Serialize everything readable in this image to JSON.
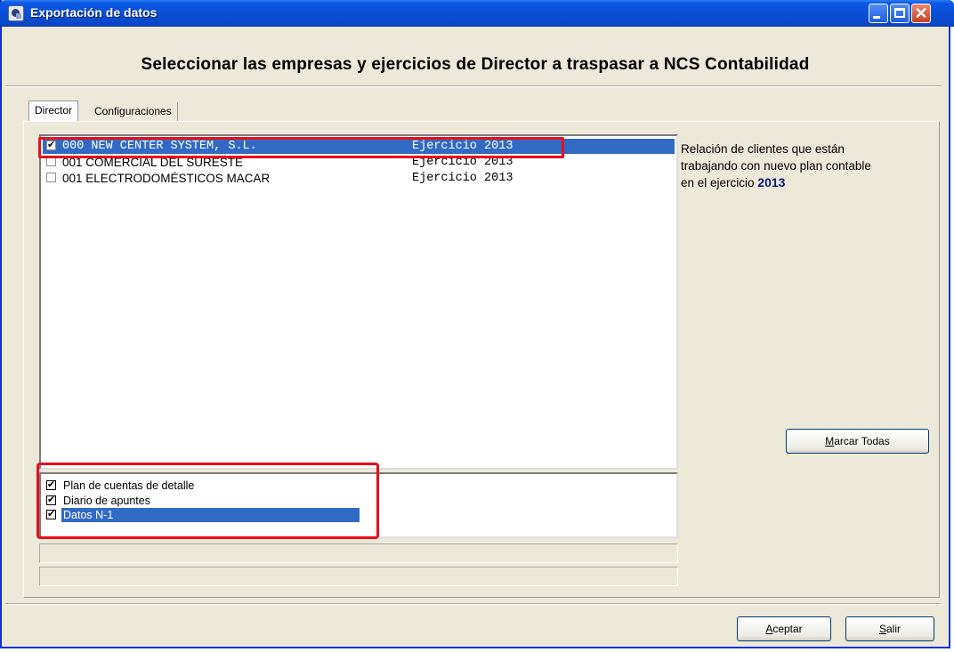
{
  "window": {
    "title": "Exportación de datos",
    "close_glyph": "✕"
  },
  "heading": "Seleccionar las empresas y ejercicios de Director a traspasar a NCS Contabilidad",
  "tabs": [
    {
      "label": "Director",
      "active": true
    },
    {
      "label": "Configuraciones",
      "active": false
    }
  ],
  "companies": [
    {
      "code": "000 NEW CENTER SYSTEM, S.L.",
      "ejercicio": "Ejercicio 2013",
      "checked": true,
      "selected": true
    },
    {
      "code": "001 COMERCIAL DEL SURESTE",
      "ejercicio": "Ejercicio 2013",
      "checked": false,
      "selected": false
    },
    {
      "code": "001 ELECTRODOMÉSTICOS MACAR",
      "ejercicio": "Ejercicio 2013",
      "checked": false,
      "selected": false
    }
  ],
  "info": {
    "line1": "Relación de clientes que  están",
    "line2": "trabajando con nuevo plan contable",
    "line3": " en el ejercicio ",
    "year": "2013"
  },
  "buttons": {
    "marcar_u": "M",
    "marcar_rest": "arcar Todas",
    "aceptar_u": "A",
    "aceptar_rest": "ceptar",
    "salir_u": "S",
    "salir_rest": "alir"
  },
  "options": [
    {
      "label": "Plan de cuentas de detalle",
      "checked": true,
      "selected": false
    },
    {
      "label": "Diario de apuntes",
      "checked": true,
      "selected": false
    },
    {
      "label": "Datos N-1",
      "checked": true,
      "selected": true
    }
  ],
  "colors": {
    "selection": "#316ac5",
    "highlight_box": "#e8101a",
    "titlebar": "#0a4fd6"
  }
}
